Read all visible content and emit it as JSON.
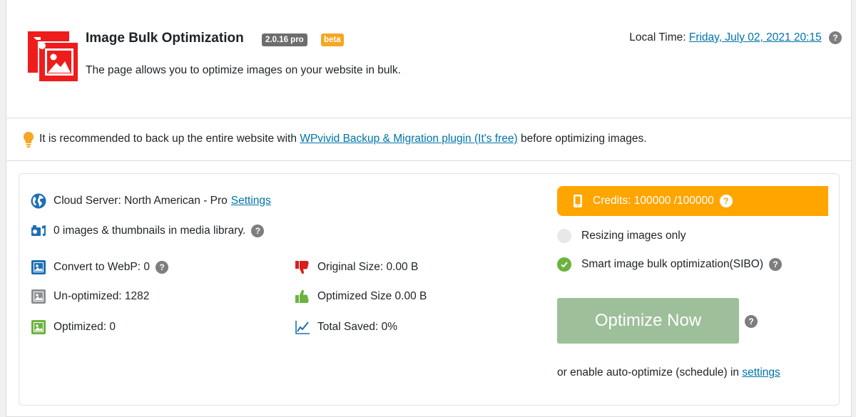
{
  "header": {
    "title": "Image Bulk Optimization",
    "version": "2.0.16 pro",
    "beta": "beta",
    "description": "The page allows you to optimize images on your website in bulk.",
    "local_time_label": "Local Time:",
    "local_time_value": "Friday, July 02, 2021 20:15"
  },
  "notice": {
    "prefix": "It is recommended to back up the entire website with",
    "link": "WPvivid Backup & Migration plugin (It's free)",
    "suffix": "before optimizing images."
  },
  "stats": {
    "cloud_server": "Cloud Server: North American - Pro",
    "settings_link": "Settings",
    "media_count": "0 images & thumbnails in media library.",
    "convert_webp": "Convert to WebP: 0",
    "unoptimized": "Un-optimized: 1282",
    "optimized": "Optimized: 0",
    "original_size": "Original Size: 0.00 B",
    "optimized_size": "Optimized Size 0.00 B",
    "total_saved": "Total Saved: 0%"
  },
  "options": {
    "credits": "Credits: 100000 /100000",
    "resizing_only": "Resizing images only",
    "sibo": "Smart image bulk optimization(SIBO)",
    "optimize_button": "Optimize Now",
    "auto_prefix": "or enable auto-optimize (schedule) in",
    "auto_link": "settings"
  },
  "colors": {
    "accent_orange": "#ffa500",
    "link_blue": "#0073aa",
    "button_green": "#9dbf9a",
    "logo_red": "#ee1c1c",
    "check_green": "#6bb33f"
  },
  "icons": {
    "logo": "image-stack-icon",
    "bulb": "lightbulb-icon",
    "globe": "globe-icon",
    "media": "media-library-icon",
    "webp": "image-blue-icon",
    "unoptimized": "image-gray-icon",
    "optimized": "image-green-icon",
    "thumbs_down": "thumbs-down-icon",
    "thumbs_up": "thumbs-up-icon",
    "chart": "trend-chart-icon",
    "phone": "phone-icon",
    "help": "question-mark-icon"
  }
}
